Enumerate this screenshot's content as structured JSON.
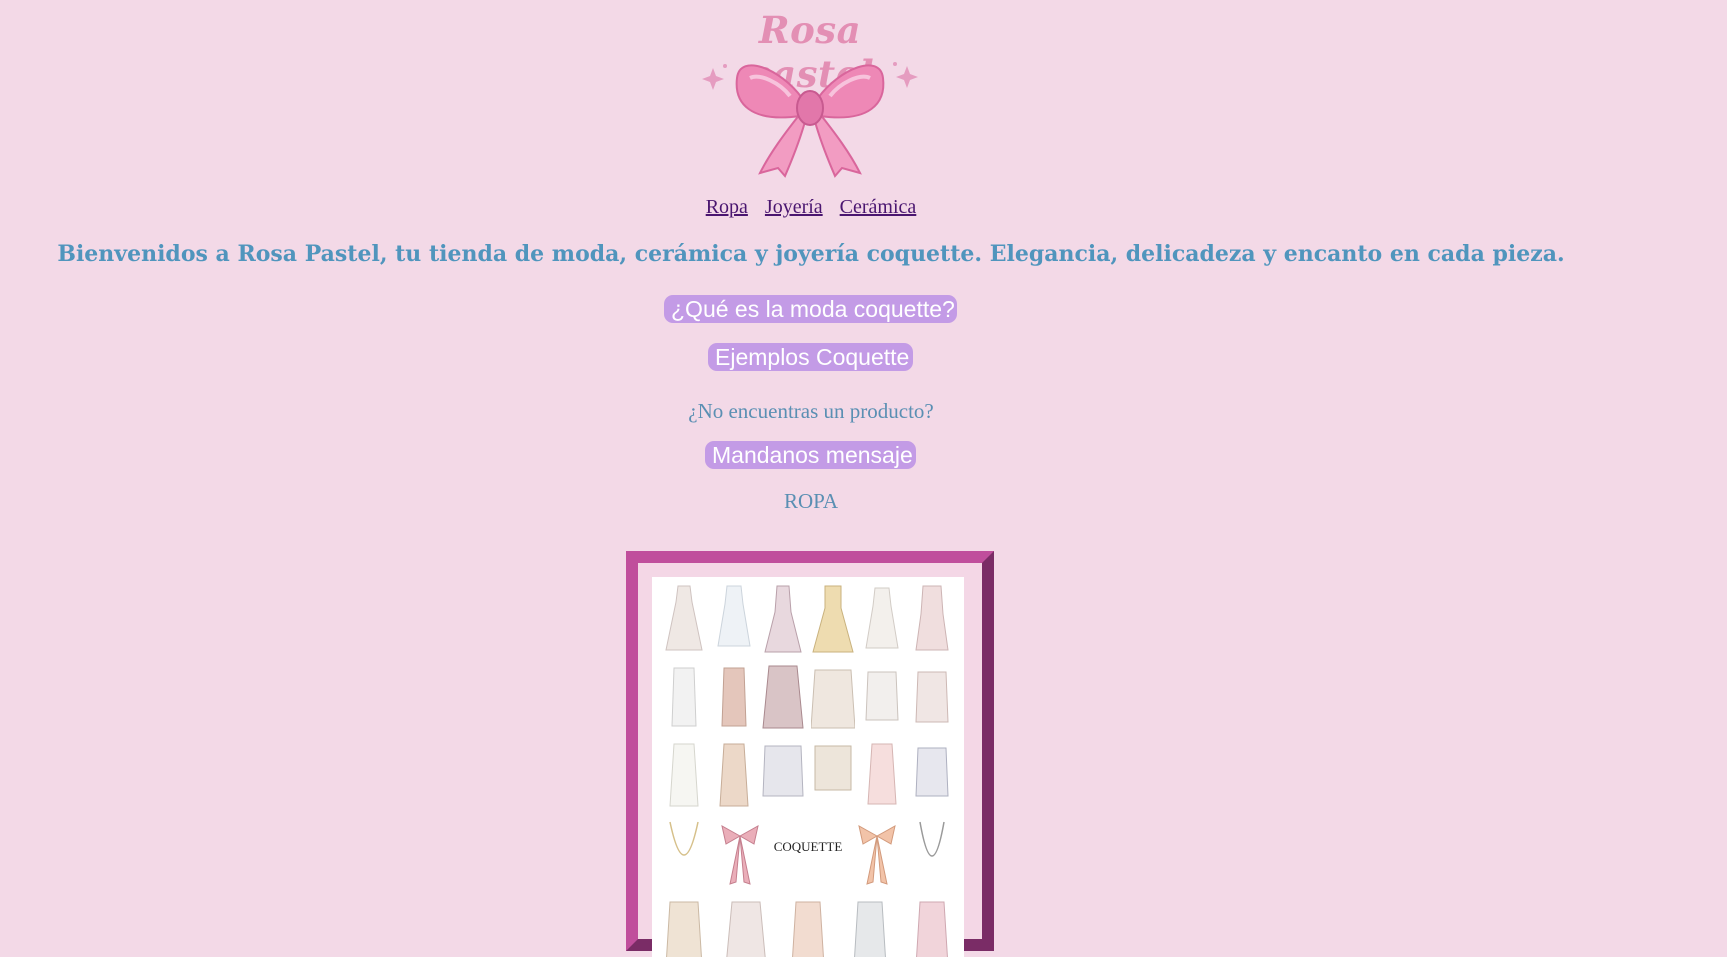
{
  "logo": {
    "title": "Rosa pastel",
    "icon": "pink-bow-icon"
  },
  "nav": {
    "links": [
      "Ropa",
      "Joyería",
      "Cerámica"
    ]
  },
  "welcome": "Bienvenidos a Rosa Pastel, tu tienda de moda, cerámica y joyería coquette. Elegancia, delicadeza y encanto en cada pieza.",
  "buttons": {
    "what_is": "¿Qué es la moda coquette?",
    "examples": "Ejemplos Coquette",
    "message": "Mandanos mensaje"
  },
  "question": "¿No encuentras un producto?",
  "section_title": "ROPA",
  "image": {
    "label": "COQUETTE"
  },
  "colors": {
    "background": "#f3d9e7",
    "button": "#c39be6",
    "text_blue": "#5095bd",
    "link": "#4a1670",
    "frame": "#c04e9c"
  }
}
